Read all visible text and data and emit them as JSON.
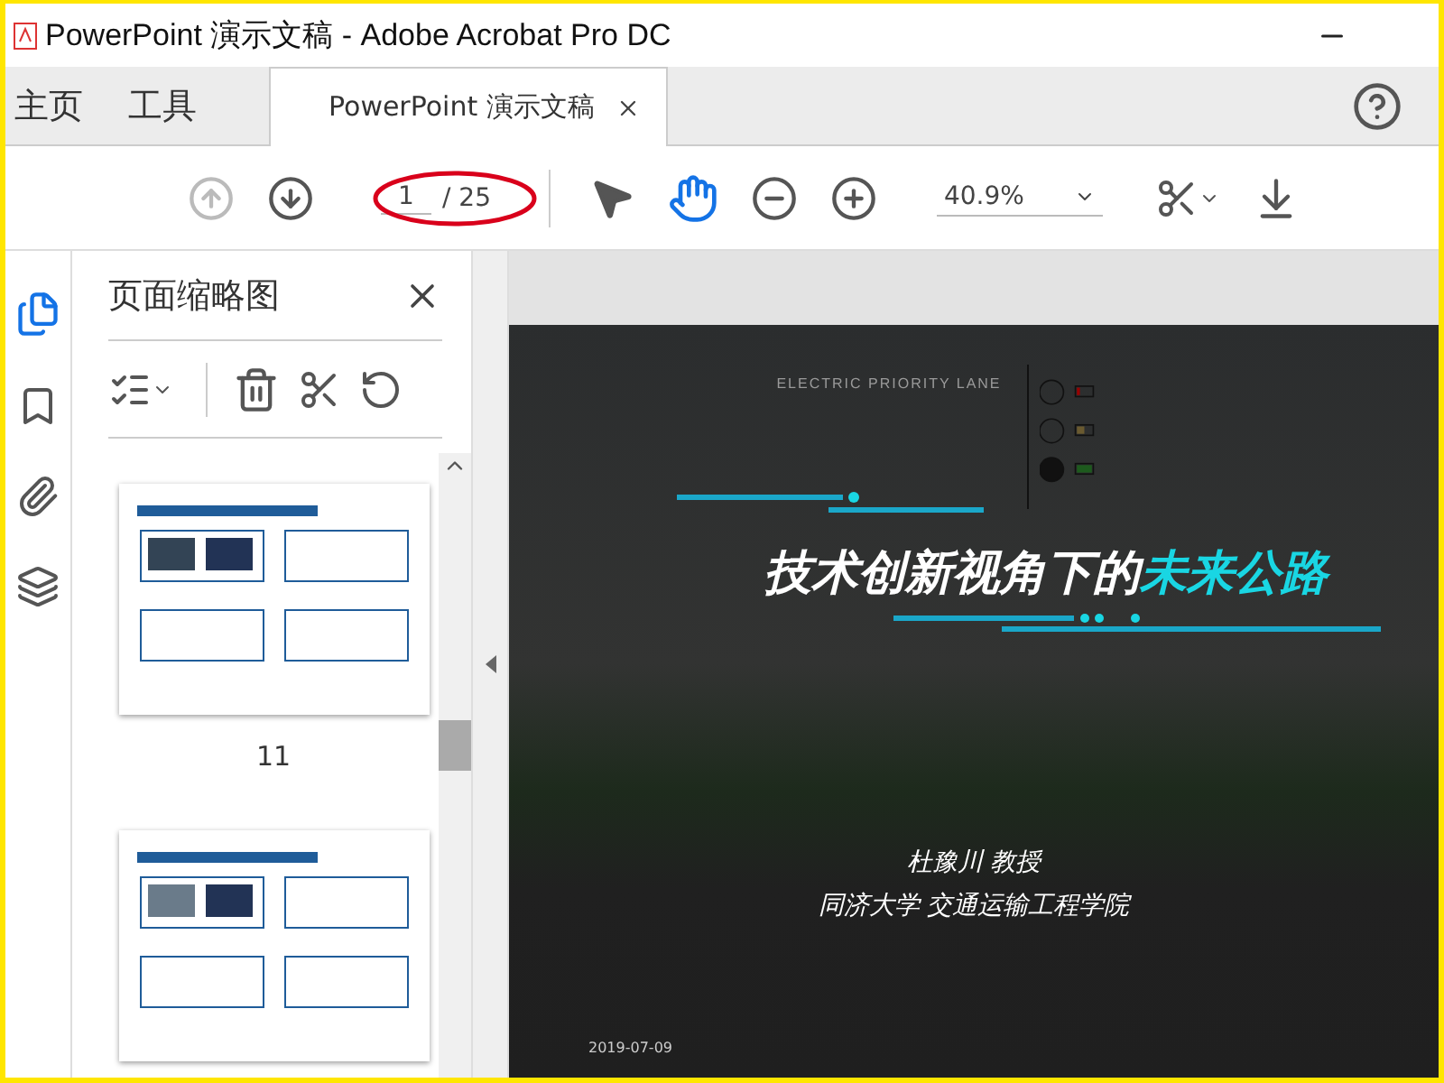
{
  "window": {
    "title": "PowerPoint 演示文稿 - Adobe Acrobat Pro DC"
  },
  "tabs": [
    {
      "label": "主页",
      "kind": "nav",
      "selected": false
    },
    {
      "label": "工具",
      "kind": "nav",
      "selected": false
    },
    {
      "label": "PowerPoint 演示文稿",
      "kind": "document",
      "selected": true
    }
  ],
  "toolbar": {
    "page_current": "1",
    "page_total": "/ 25",
    "zoom": "40.9%"
  },
  "side_panel": {
    "title": "页面缩略图",
    "thumbnails": [
      {
        "kind": "labelled",
        "label": "11"
      },
      {
        "kind": "partial"
      }
    ]
  },
  "slide": {
    "lane_label": "ELECTRIC PRIORITY LANE",
    "title": "技术创新视角下的",
    "title_accent": "未来公路",
    "author": "杜豫川 教授",
    "affiliation": "同济大学 交通运输工程学院",
    "date": "2019-07-09"
  }
}
